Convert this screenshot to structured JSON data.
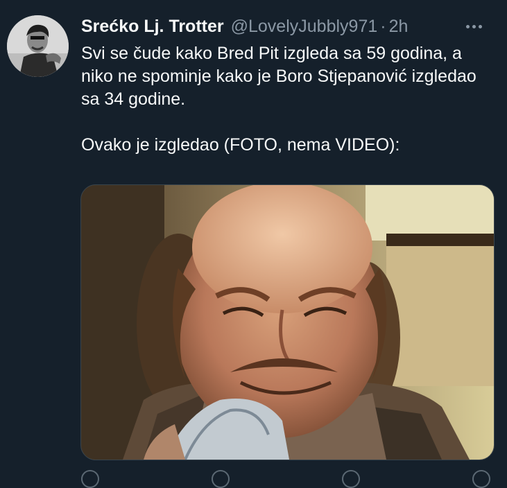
{
  "tweet": {
    "display_name": "Srećko Lj. Trotter",
    "handle": "@LovelyJubbly971",
    "separator": "·",
    "time": "2h",
    "paragraphs": [
      "Svi se čude kako Bred Pit izgleda sa 59 godina, a niko ne spominje kako je Boro Stjepanović izgledao sa 34 godine.",
      "Ovako je izgledao (FOTO, nema VIDEO):"
    ]
  },
  "icons": {
    "more": "more-horizontal-icon",
    "reply": "reply-icon",
    "retweet": "retweet-icon",
    "like": "like-icon",
    "share": "share-icon"
  },
  "colors": {
    "background": "#15202b",
    "primary_text": "#f7f9f9",
    "secondary_text": "#8b98a5",
    "border": "#38444d"
  }
}
